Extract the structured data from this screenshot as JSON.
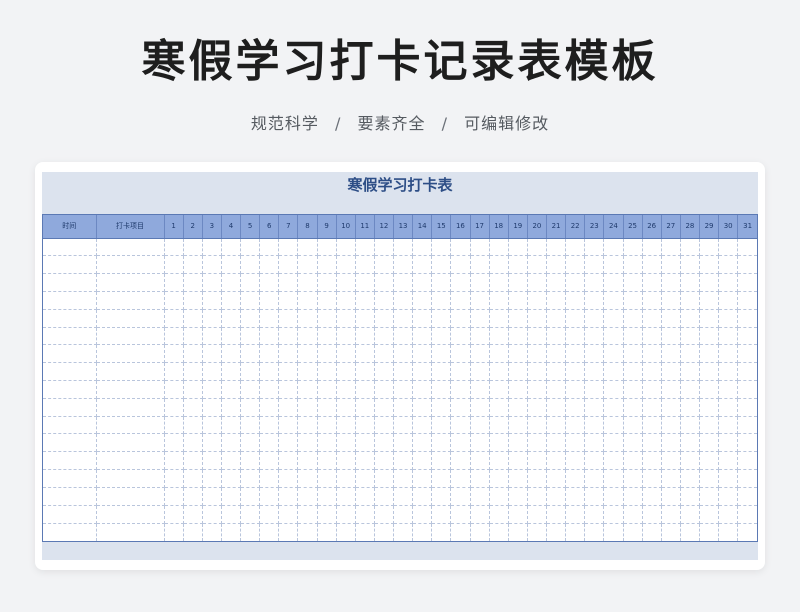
{
  "header": {
    "title": "寒假学习打卡记录表模板",
    "features": [
      "规范科学",
      "要素齐全",
      "可编辑修改"
    ],
    "separator": "/"
  },
  "sheet": {
    "title": "寒假学习打卡表",
    "columns": {
      "time": "时间",
      "project": "打卡项目",
      "days": [
        "1",
        "2",
        "3",
        "4",
        "5",
        "6",
        "7",
        "8",
        "9",
        "10",
        "11",
        "12",
        "13",
        "14",
        "15",
        "16",
        "17",
        "18",
        "19",
        "20",
        "21",
        "22",
        "23",
        "24",
        "25",
        "26",
        "27",
        "28",
        "29",
        "30",
        "31"
      ]
    },
    "empty_row_count": 17
  },
  "colors": {
    "background": "#f2f3f5",
    "header_fill": "#8fa9dc",
    "border": "#5b79b4",
    "title_blue": "#2d4e86"
  }
}
